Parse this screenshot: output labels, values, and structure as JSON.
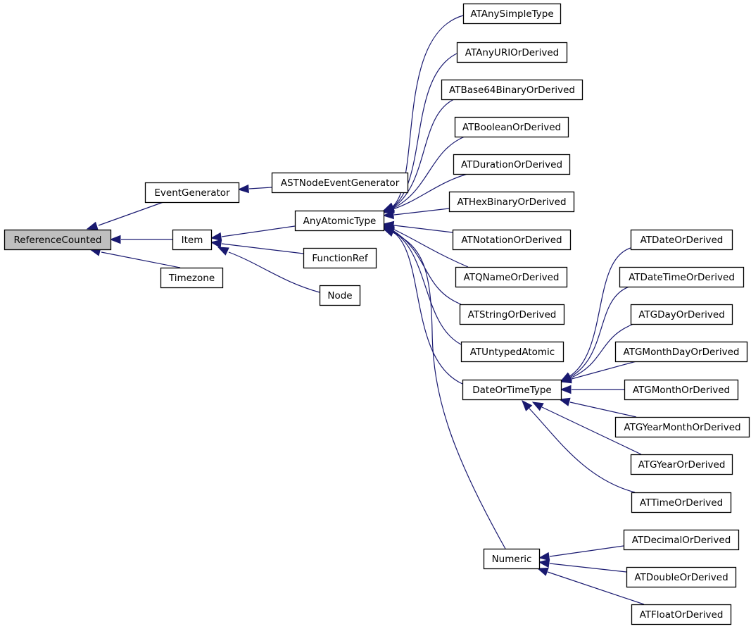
{
  "diagram": {
    "type": "class-inheritance-graph",
    "colors": {
      "edge": "#191970",
      "root_fill": "#bfbfbf",
      "node_fill": "#ffffff",
      "border": "#000000"
    },
    "nodes": [
      {
        "id": "ReferenceCounted",
        "label": "ReferenceCounted",
        "root": true
      },
      {
        "id": "EventGenerator",
        "label": "EventGenerator"
      },
      {
        "id": "ASTNodeEventGenerator",
        "label": "ASTNodeEventGenerator"
      },
      {
        "id": "Item",
        "label": "Item"
      },
      {
        "id": "Timezone",
        "label": "Timezone"
      },
      {
        "id": "AnyAtomicType",
        "label": "AnyAtomicType"
      },
      {
        "id": "FunctionRef",
        "label": "FunctionRef"
      },
      {
        "id": "Node",
        "label": "Node"
      },
      {
        "id": "ATAnySimpleType",
        "label": "ATAnySimpleType"
      },
      {
        "id": "ATAnyURIOrDerived",
        "label": "ATAnyURIOrDerived"
      },
      {
        "id": "ATBase64BinaryOrDerived",
        "label": "ATBase64BinaryOrDerived"
      },
      {
        "id": "ATBooleanOrDerived",
        "label": "ATBooleanOrDerived"
      },
      {
        "id": "ATDurationOrDerived",
        "label": "ATDurationOrDerived"
      },
      {
        "id": "ATHexBinaryOrDerived",
        "label": "ATHexBinaryOrDerived"
      },
      {
        "id": "ATNotationOrDerived",
        "label": "ATNotationOrDerived"
      },
      {
        "id": "ATQNameOrDerived",
        "label": "ATQNameOrDerived"
      },
      {
        "id": "ATStringOrDerived",
        "label": "ATStringOrDerived"
      },
      {
        "id": "ATUntypedAtomic",
        "label": "ATUntypedAtomic"
      },
      {
        "id": "DateOrTimeType",
        "label": "DateOrTimeType"
      },
      {
        "id": "Numeric",
        "label": "Numeric"
      },
      {
        "id": "ATDateOrDerived",
        "label": "ATDateOrDerived"
      },
      {
        "id": "ATDateTimeOrDerived",
        "label": "ATDateTimeOrDerived"
      },
      {
        "id": "ATGDayOrDerived",
        "label": "ATGDayOrDerived"
      },
      {
        "id": "ATGMonthDayOrDerived",
        "label": "ATGMonthDayOrDerived"
      },
      {
        "id": "ATGMonthOrDerived",
        "label": "ATGMonthOrDerived"
      },
      {
        "id": "ATGYearMonthOrDerived",
        "label": "ATGYearMonthOrDerived"
      },
      {
        "id": "ATGYearOrDerived",
        "label": "ATGYearOrDerived"
      },
      {
        "id": "ATTimeOrDerived",
        "label": "ATTimeOrDerived"
      },
      {
        "id": "ATDecimalOrDerived",
        "label": "ATDecimalOrDerived"
      },
      {
        "id": "ATDoubleOrDerived",
        "label": "ATDoubleOrDerived"
      },
      {
        "id": "ATFloatOrDerived",
        "label": "ATFloatOrDerived"
      }
    ],
    "edges": [
      {
        "from": "EventGenerator",
        "to": "ReferenceCounted"
      },
      {
        "from": "Item",
        "to": "ReferenceCounted"
      },
      {
        "from": "Timezone",
        "to": "ReferenceCounted"
      },
      {
        "from": "ASTNodeEventGenerator",
        "to": "EventGenerator"
      },
      {
        "from": "AnyAtomicType",
        "to": "Item"
      },
      {
        "from": "FunctionRef",
        "to": "Item"
      },
      {
        "from": "Node",
        "to": "Item"
      },
      {
        "from": "ATAnySimpleType",
        "to": "AnyAtomicType"
      },
      {
        "from": "ATAnyURIOrDerived",
        "to": "AnyAtomicType"
      },
      {
        "from": "ATBase64BinaryOrDerived",
        "to": "AnyAtomicType"
      },
      {
        "from": "ATBooleanOrDerived",
        "to": "AnyAtomicType"
      },
      {
        "from": "ATDurationOrDerived",
        "to": "AnyAtomicType"
      },
      {
        "from": "ATHexBinaryOrDerived",
        "to": "AnyAtomicType"
      },
      {
        "from": "ATNotationOrDerived",
        "to": "AnyAtomicType"
      },
      {
        "from": "ATQNameOrDerived",
        "to": "AnyAtomicType"
      },
      {
        "from": "ATStringOrDerived",
        "to": "AnyAtomicType"
      },
      {
        "from": "ATUntypedAtomic",
        "to": "AnyAtomicType"
      },
      {
        "from": "DateOrTimeType",
        "to": "AnyAtomicType"
      },
      {
        "from": "Numeric",
        "to": "AnyAtomicType"
      },
      {
        "from": "ATDateOrDerived",
        "to": "DateOrTimeType"
      },
      {
        "from": "ATDateTimeOrDerived",
        "to": "DateOrTimeType"
      },
      {
        "from": "ATGDayOrDerived",
        "to": "DateOrTimeType"
      },
      {
        "from": "ATGMonthDayOrDerived",
        "to": "DateOrTimeType"
      },
      {
        "from": "ATGMonthOrDerived",
        "to": "DateOrTimeType"
      },
      {
        "from": "ATGYearMonthOrDerived",
        "to": "DateOrTimeType"
      },
      {
        "from": "ATGYearOrDerived",
        "to": "DateOrTimeType"
      },
      {
        "from": "ATTimeOrDerived",
        "to": "DateOrTimeType"
      },
      {
        "from": "ATDecimalOrDerived",
        "to": "Numeric"
      },
      {
        "from": "ATDoubleOrDerived",
        "to": "Numeric"
      },
      {
        "from": "ATFloatOrDerived",
        "to": "Numeric"
      }
    ]
  }
}
